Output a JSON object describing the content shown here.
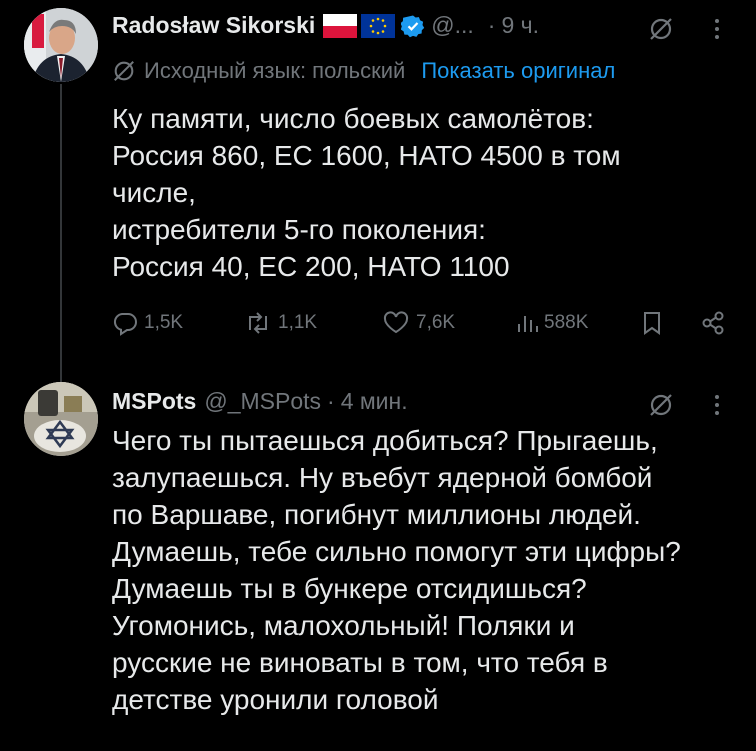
{
  "tweet1": {
    "author_name": "Radosław Sikorski",
    "handle": "@...",
    "separator": "·",
    "time": "9 ч.",
    "translate_note": "Исходный язык: польский",
    "show_original": "Показать оригинал",
    "text": "Ку памяти, число боевых самолётов:\nРоссия 860, ЕС 1600, НАТО 4500 в том\nчисле,\nистребители 5-го поколения:\nРоссия 40, ЕС 200, НАТО 1100",
    "replies": "1,5K",
    "reposts": "1,1K",
    "likes": "7,6K",
    "views": "588K",
    "colors": {
      "verified": "#1d9bf0",
      "flag_pl_red": "#dc143c",
      "flag_eu_blue": "#003399"
    }
  },
  "tweet2": {
    "author_name": "MSPots",
    "handle": "@_MSPots",
    "separator": "·",
    "time": "4 мин.",
    "text": "Чего ты пытаешься добиться? Прыгаешь,\nзалупаешься. Ну въебут ядерной бомбой\nпо Варшаве, погибнут миллионы людей.\nДумаешь, тебе сильно помогут эти цифры?\nДумаешь ты в бункере отсидишься?\nУгомонись, малохольный! Поляки и\nрусские не виноваты в том, что тебя в\nдетстве уронили головой"
  },
  "icons": [
    "grok-icon",
    "more-icon",
    "reply-icon",
    "repost-icon",
    "like-icon",
    "views-icon",
    "bookmark-icon",
    "share-icon",
    "verified-icon"
  ]
}
